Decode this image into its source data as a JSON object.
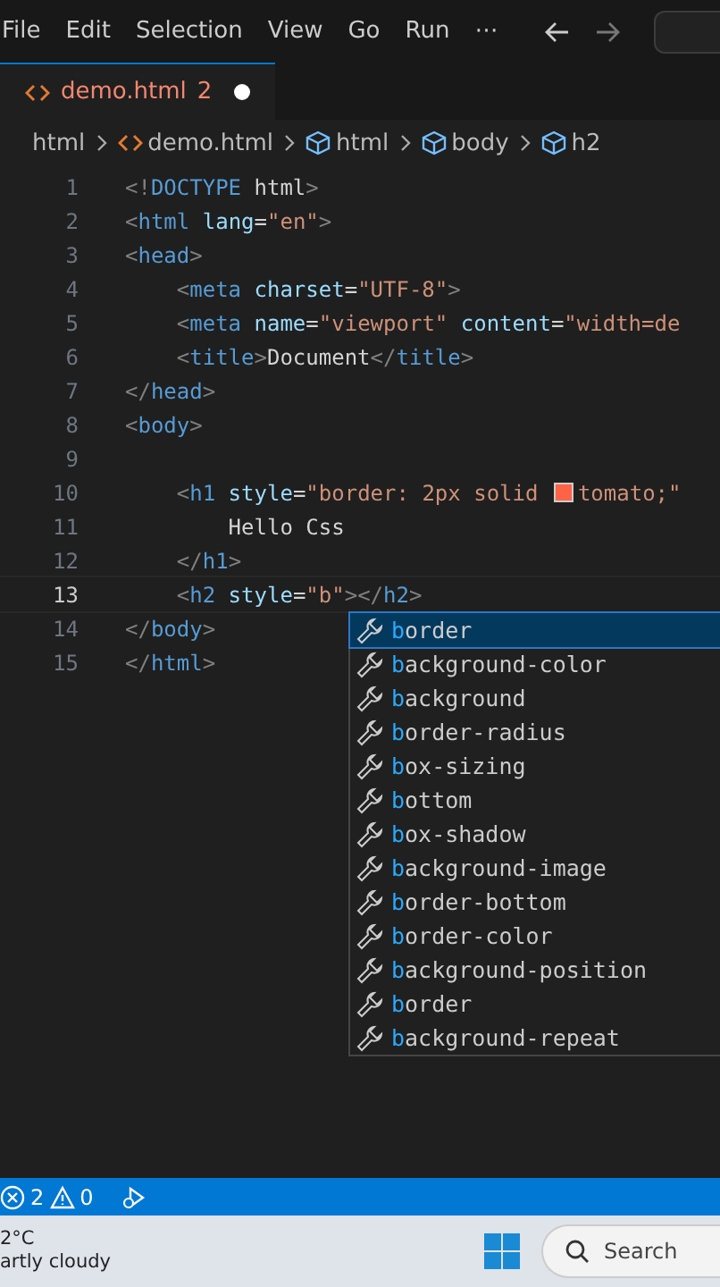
{
  "menu": [
    "File",
    "Edit",
    "Selection",
    "View",
    "Go",
    "Run",
    "⋯"
  ],
  "tab": {
    "title": "demo.html",
    "problems": "2",
    "modified": true,
    "selected": true
  },
  "breadcrumbs": [
    {
      "kind": "folder",
      "label": "html"
    },
    {
      "kind": "file",
      "label": "demo.html"
    },
    {
      "kind": "element",
      "label": "html"
    },
    {
      "kind": "element",
      "label": "body"
    },
    {
      "kind": "element",
      "label": "h2"
    }
  ],
  "lines": [
    {
      "number": "1",
      "current": false,
      "tokens": [
        {
          "kind": "punct",
          "text": "<!"
        },
        {
          "kind": "tag",
          "text": "DOCTYPE"
        },
        {
          "kind": "text",
          "text": " html"
        },
        {
          "kind": "punct",
          "text": ">"
        }
      ]
    },
    {
      "number": "2",
      "current": false,
      "tokens": [
        {
          "kind": "punct",
          "text": "<"
        },
        {
          "kind": "tag",
          "text": "html"
        },
        {
          "kind": "attr",
          "text": " lang"
        },
        {
          "kind": "text",
          "text": "="
        },
        {
          "kind": "string",
          "text": "\"en\""
        },
        {
          "kind": "punct",
          "text": ">"
        }
      ]
    },
    {
      "number": "3",
      "current": false,
      "tokens": [
        {
          "kind": "punct",
          "text": "<"
        },
        {
          "kind": "tag",
          "text": "head"
        },
        {
          "kind": "punct",
          "text": ">"
        }
      ]
    },
    {
      "number": "4",
      "current": false,
      "tokens": [
        {
          "kind": "punct",
          "text": "    <"
        },
        {
          "kind": "tag",
          "text": "meta"
        },
        {
          "kind": "attr",
          "text": " charset"
        },
        {
          "kind": "text",
          "text": "="
        },
        {
          "kind": "string",
          "text": "\"UTF-8\""
        },
        {
          "kind": "punct",
          "text": ">"
        }
      ]
    },
    {
      "number": "5",
      "current": false,
      "tokens": [
        {
          "kind": "punct",
          "text": "    <"
        },
        {
          "kind": "tag",
          "text": "meta"
        },
        {
          "kind": "attr",
          "text": " name"
        },
        {
          "kind": "text",
          "text": "="
        },
        {
          "kind": "string",
          "text": "\"viewport\""
        },
        {
          "kind": "attr",
          "text": " content"
        },
        {
          "kind": "text",
          "text": "="
        },
        {
          "kind": "string",
          "text": "\"width=de"
        }
      ]
    },
    {
      "number": "6",
      "current": false,
      "tokens": [
        {
          "kind": "punct",
          "text": "    <"
        },
        {
          "kind": "tag",
          "text": "title"
        },
        {
          "kind": "punct",
          "text": ">"
        },
        {
          "kind": "text",
          "text": "Document"
        },
        {
          "kind": "punct",
          "text": "</"
        },
        {
          "kind": "tag",
          "text": "title"
        },
        {
          "kind": "punct",
          "text": ">"
        }
      ]
    },
    {
      "number": "7",
      "current": false,
      "tokens": [
        {
          "kind": "punct",
          "text": "</"
        },
        {
          "kind": "tag",
          "text": "head"
        },
        {
          "kind": "punct",
          "text": ">"
        }
      ]
    },
    {
      "number": "8",
      "current": false,
      "tokens": [
        {
          "kind": "punct",
          "text": "<"
        },
        {
          "kind": "tag",
          "text": "body"
        },
        {
          "kind": "punct",
          "text": ">"
        }
      ]
    },
    {
      "number": "9",
      "current": false
    },
    {
      "number": "10",
      "current": false,
      "tokens": [
        {
          "kind": "punct",
          "text": "    <"
        },
        {
          "kind": "tag",
          "text": "h1"
        },
        {
          "kind": "attr",
          "text": " style"
        },
        {
          "kind": "text",
          "text": "="
        },
        {
          "kind": "string",
          "text": "\"border: 2px solid "
        },
        {
          "kind": "swatch",
          "color": "#ff6347"
        },
        {
          "kind": "string",
          "text": "tomato;\""
        }
      ]
    },
    {
      "number": "11",
      "current": false,
      "tokens": [
        {
          "kind": "text",
          "text": "        Hello Css"
        }
      ]
    },
    {
      "number": "12",
      "current": false,
      "tokens": [
        {
          "kind": "punct",
          "text": "    </"
        },
        {
          "kind": "tag",
          "text": "h1"
        },
        {
          "kind": "punct",
          "text": ">"
        }
      ]
    },
    {
      "number": "13",
      "current": true,
      "tokens": [
        {
          "kind": "punct",
          "text": "    <"
        },
        {
          "kind": "tag",
          "text": "h2"
        },
        {
          "kind": "attr",
          "text": " style"
        },
        {
          "kind": "text",
          "text": "="
        },
        {
          "kind": "string",
          "text": "\"b\""
        },
        {
          "kind": "punct",
          "text": "></"
        },
        {
          "kind": "tag",
          "text": "h2"
        },
        {
          "kind": "punct",
          "text": ">"
        }
      ]
    },
    {
      "number": "14",
      "current": false,
      "tokens": [
        {
          "kind": "punct",
          "text": "</"
        },
        {
          "kind": "tag",
          "text": "body"
        },
        {
          "kind": "punct",
          "text": ">"
        }
      ]
    },
    {
      "number": "15",
      "current": false,
      "tokens": [
        {
          "kind": "punct",
          "text": "</"
        },
        {
          "kind": "tag",
          "text": "html"
        },
        {
          "kind": "punct",
          "text": ">"
        }
      ]
    }
  ],
  "suggest": {
    "items": [
      {
        "match": "b",
        "rest": "order",
        "selected": true
      },
      {
        "match": "b",
        "rest": "ackground-color",
        "selected": false
      },
      {
        "match": "b",
        "rest": "ackground",
        "selected": false
      },
      {
        "match": "b",
        "rest": "order-radius",
        "selected": false
      },
      {
        "match": "b",
        "rest": "ox-sizing",
        "selected": false
      },
      {
        "match": "b",
        "rest": "ottom",
        "selected": false
      },
      {
        "match": "b",
        "rest": "ox-shadow",
        "selected": false
      },
      {
        "match": "b",
        "rest": "ackground-image",
        "selected": false
      },
      {
        "match": "b",
        "rest": "order-bottom",
        "selected": false
      },
      {
        "match": "b",
        "rest": "order-color",
        "selected": false
      },
      {
        "match": "b",
        "rest": "ackground-position",
        "selected": false
      },
      {
        "match": "b",
        "rest": "order",
        "selected": false
      },
      {
        "match": "b",
        "rest": "ackground-repeat",
        "selected": false
      }
    ]
  },
  "status_bar": {
    "errors": "2",
    "warnings": "0"
  },
  "taskbar": {
    "temperature": "2°C",
    "weather": "artly cloudy",
    "search_placeholder": "Search"
  }
}
